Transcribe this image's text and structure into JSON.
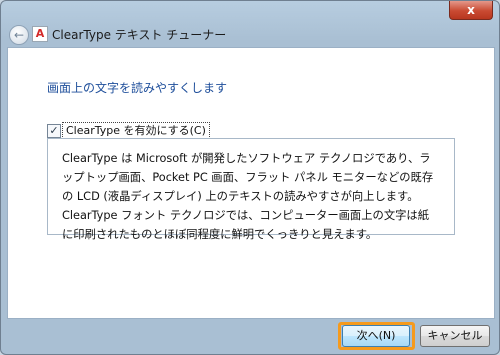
{
  "window": {
    "title": "ClearType テキスト チューナー",
    "close_label": "x"
  },
  "icons": {
    "back": "back-arrow-icon",
    "app": "cleartype-app-icon",
    "app_glyph": "A"
  },
  "content": {
    "heading": "画面上の文字を読みやすくします",
    "checkbox": {
      "checked": true,
      "mark": "✓",
      "label": "ClearType を有効にする(C)"
    },
    "description": "ClearType は Microsoft が開発したソフトウェア テクノロジであり、ラップトップ画面、Pocket PC 画面、フラット パネル モニターなどの既存の LCD (液晶ディスプレイ) 上のテキストの読みやすさが向上します。ClearType フォント テクノロジでは、コンピューター画面上の文字は紙に印刷されたものとほぼ同程度に鮮明でくっきりと見えます。"
  },
  "buttons": {
    "next": "次へ(N)",
    "cancel": "キャンセル"
  },
  "colors": {
    "heading": "#1f4f9b",
    "highlight": "#f59a1d"
  }
}
